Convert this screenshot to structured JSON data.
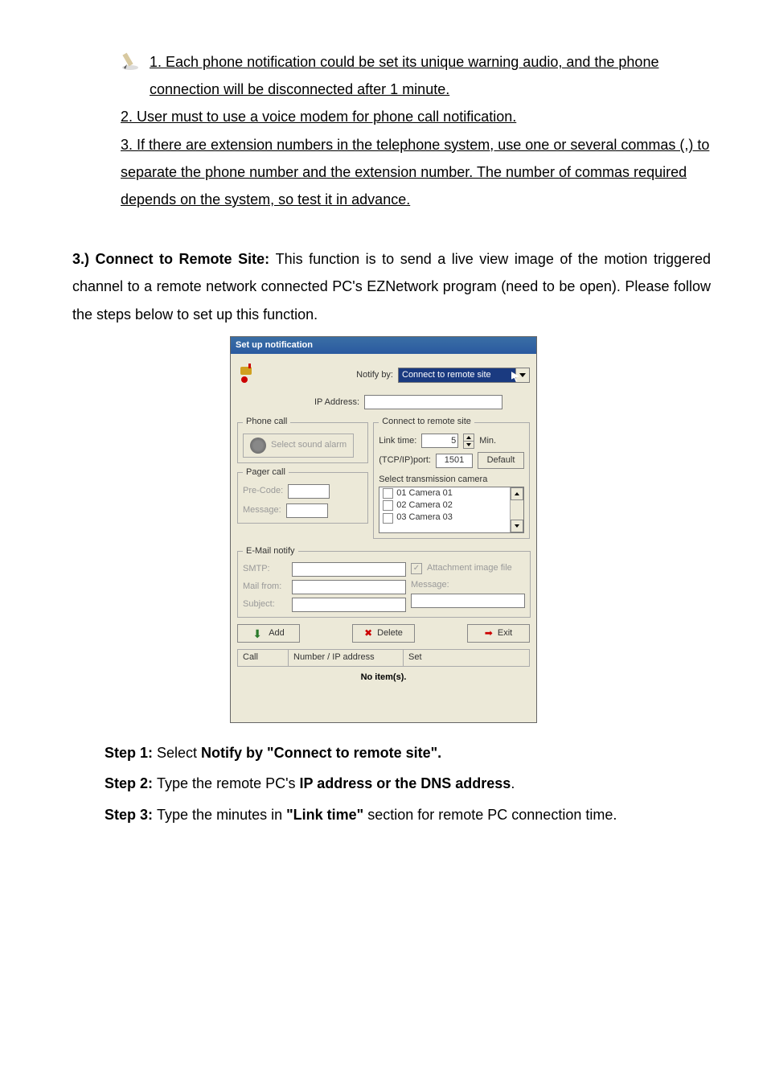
{
  "notes": {
    "item1": "1. Each phone notification could be set its unique warning audio, and the phone connection will be disconnected after 1 minute.",
    "item2": "2. User must to use a voice modem for phone call notification.",
    "item3": "3. If there are extension numbers in the telephone system, use one or several commas (,) to separate the phone number and the extension number. The number of commas required depends on the system, so test it in advance."
  },
  "section3": {
    "lead": "3.) ",
    "title": "Connect to Remote Site: ",
    "body": "This function is to send a live view image of the motion triggered channel to a remote network connected PC's EZNetwork program (need to be open). Please follow the steps below to set up this function."
  },
  "dialog": {
    "title": "Set up notification",
    "notify_by_label": "Notify by:",
    "notify_by_value": "Connect to remote site",
    "ip_label": "IP Address:",
    "phone": {
      "legend": "Phone call",
      "sound_btn": "Select sound alarm"
    },
    "remote": {
      "legend": "Connect to remote site",
      "link_label": "Link time:",
      "link_value": "5",
      "min": "Min.",
      "port_label": "(TCP/IP)port:",
      "port_value": "1501",
      "default_btn": "Default",
      "cam_label": "Select transmission camera",
      "cam1": "01 Camera 01",
      "cam2": "02 Camera 02",
      "cam3": "03 Camera 03"
    },
    "pager": {
      "legend": "Pager call",
      "pre": "Pre-Code:",
      "msg": "Message:"
    },
    "mail": {
      "legend": "E-Mail notify",
      "smtp": "SMTP:",
      "from": "Mail from:",
      "subj": "Subject:",
      "attach": "Attachment image file",
      "msg": "Message:"
    },
    "buttons": {
      "add": "Add",
      "delete": "Delete",
      "exit": "Exit"
    },
    "table": {
      "col1": "Call",
      "col2": "Number / IP address",
      "col3": "Set",
      "empty": "No item(s)."
    }
  },
  "steps": {
    "s1a": "Step 1: ",
    "s1b": "Select ",
    "s1c": "Notify by \"Connect to remote site\".",
    "s2a": "Step 2: ",
    "s2b": "Type the remote PC's ",
    "s2c": "IP address or the DNS address",
    "s2d": ".",
    "s3a": "Step 3: ",
    "s3b": "Type the minutes in ",
    "s3c": "\"Link time\"",
    "s3d": " section for remote PC connection time."
  }
}
